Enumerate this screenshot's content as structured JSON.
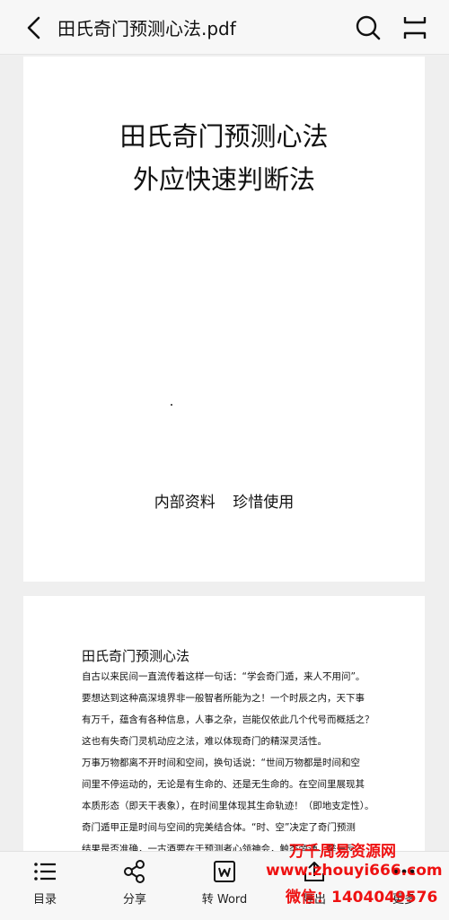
{
  "header": {
    "title": "田氏奇门预测心法.pdf"
  },
  "cover": {
    "title_line1": "田氏奇门预测心法",
    "title_line2": "外应快速判断法",
    "footer": "内部资料 珍惜使用"
  },
  "page2": {
    "heading": "田氏奇门预测心法",
    "lines": [
      "自古以来民间一直流传着这样一句话：“学会奇门遁，来人不用问”。",
      "要想达到这种高深境界非一般智者所能为之！一个时辰之内，天下事",
      "有万千，蕴含有各种信息，人事之杂，岂能仅依此几个代号而概括之？",
      "这也有失奇门灵机动应之法，难以体现奇门的精深灵活性。",
      "万事万物都离不开时间和空间，换句话说：“世间万物都是时间和空",
      "间里不停运动的，无论是有生命的、还是无生命的。在空间里展现其",
      "本质形态（即天干表象），在时间里体现其生命轨迹！（即地支定性）。",
      "奇门遁甲正是时间与空间的完美结合体。“时、空”决定了奇门预测",
      "结果是否准确，一古酒要在于预测者心领神会，触类旁通，举一反三"
    ]
  },
  "toolbar": {
    "toc_label": "目录",
    "share_label": "分享",
    "word_label": "转 Word",
    "export_label": "导出",
    "more_label": "更多"
  },
  "watermark": {
    "line1": "万千周易资源网",
    "line2": "www.zhouyi666.com",
    "line3": "微信：1404049576"
  }
}
